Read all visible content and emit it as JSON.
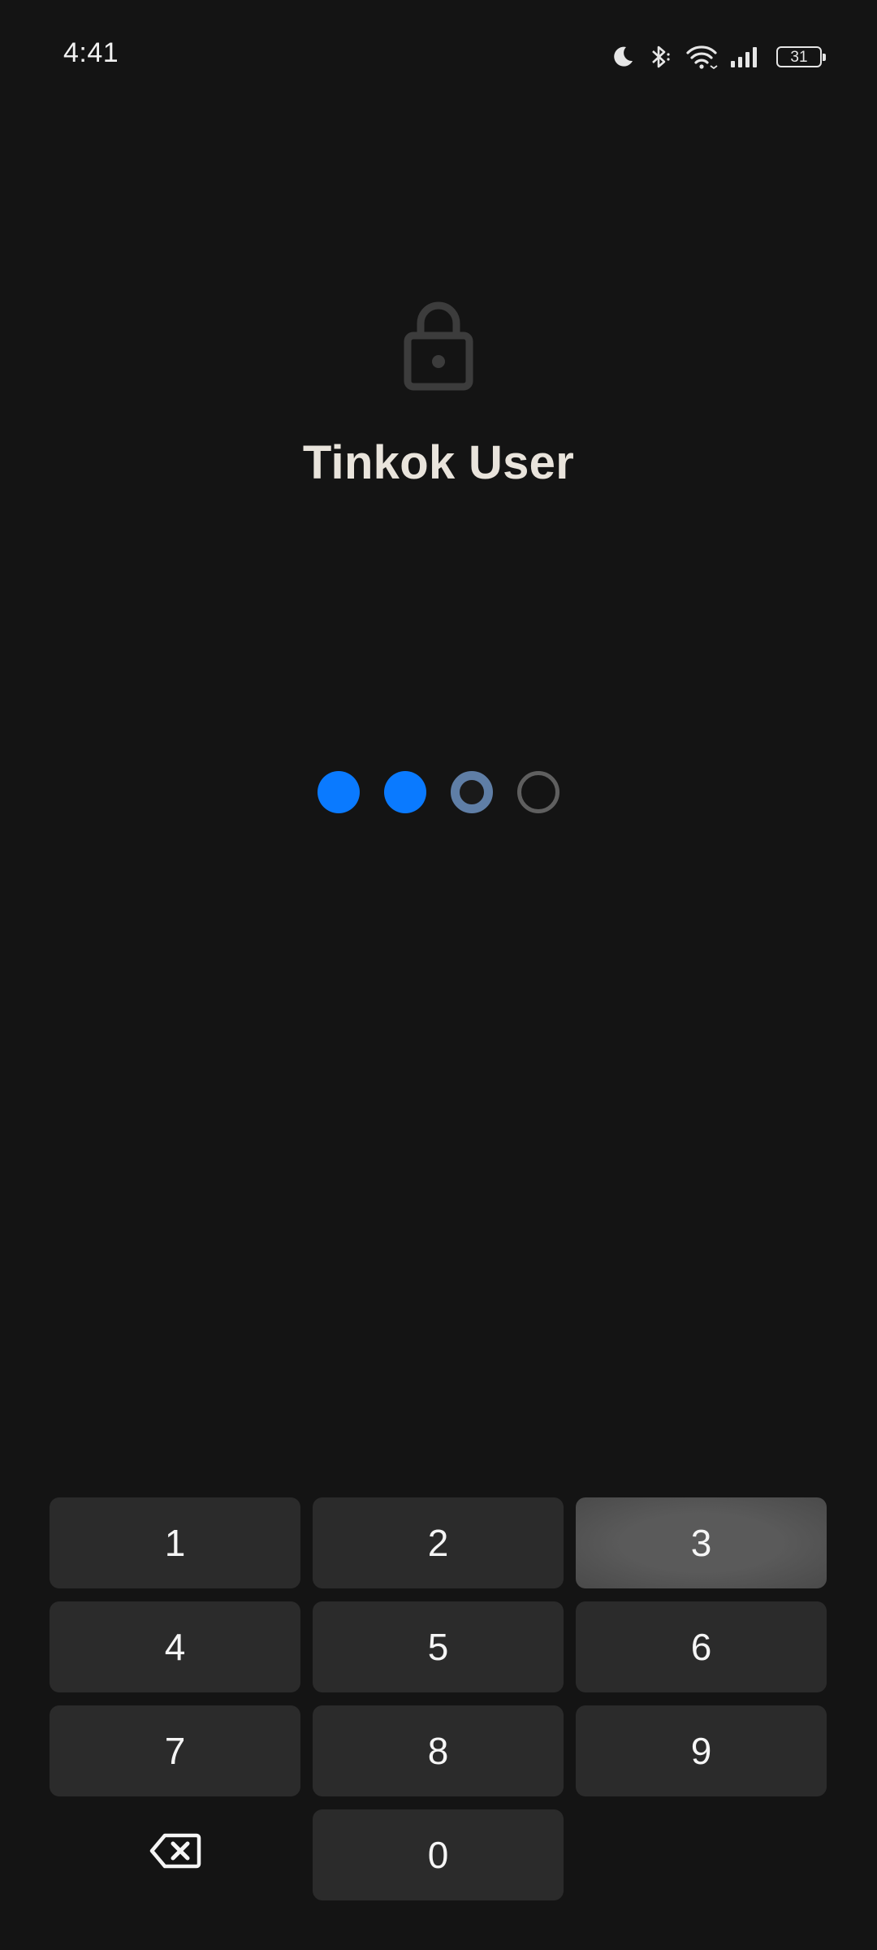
{
  "status_bar": {
    "time": "4:41",
    "icons": [
      "moon-icon",
      "bluetooth-icon",
      "wifi-icon",
      "signal-icon"
    ],
    "battery_level": "31"
  },
  "lock_screen": {
    "icon": "lock-icon",
    "title": "Tinkok User"
  },
  "pin": {
    "length": 4,
    "entered": 2,
    "dot_colors": {
      "filled": "#0a7aff",
      "active": "#5f7ea6",
      "empty": "#5f5f5f"
    }
  },
  "keypad": {
    "keys": [
      "1",
      "2",
      "3",
      "4",
      "5",
      "6",
      "7",
      "8",
      "9",
      "",
      "0",
      ""
    ],
    "pressed_key": "3",
    "backspace_icon": "backspace-icon"
  },
  "colors": {
    "background": "#141414",
    "key_background": "#2b2b2b",
    "title": "#e9e4dc",
    "accent": "#0a7aff"
  }
}
